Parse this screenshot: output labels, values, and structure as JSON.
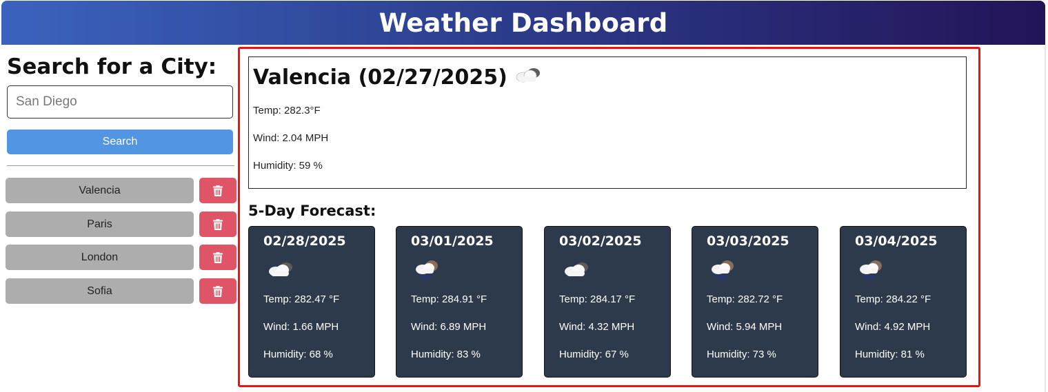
{
  "header": {
    "title": "Weather Dashboard"
  },
  "sidebar": {
    "search_title": "Search for a City:",
    "search_value": "",
    "search_placeholder": "San Diego",
    "search_button": "Search",
    "history": [
      {
        "city": "Valencia",
        "delete_icon": "trash-icon"
      },
      {
        "city": "Paris",
        "delete_icon": "trash-icon"
      },
      {
        "city": "London",
        "delete_icon": "trash-icon"
      },
      {
        "city": "Sofia",
        "delete_icon": "trash-icon"
      }
    ]
  },
  "current": {
    "title": "Valencia (02/27/2025)",
    "icon": "cloud-icon",
    "temp": "Temp: 282.3°F",
    "wind": "Wind: 2.04 MPH",
    "humidity": "Humidity: 59 %"
  },
  "forecast": {
    "title": "5-Day Forecast:",
    "days": [
      {
        "date": "02/28/2025",
        "icon": "cloud-icon",
        "temp": "Temp: 282.47 °F",
        "wind": "Wind: 1.66 MPH",
        "humidity": "Humidity: 68 %"
      },
      {
        "date": "03/01/2025",
        "icon": "rain-cloud-icon",
        "temp": "Temp: 284.91 °F",
        "wind": "Wind: 6.89 MPH",
        "humidity": "Humidity: 83 %"
      },
      {
        "date": "03/02/2025",
        "icon": "cloud-icon",
        "temp": "Temp: 284.17 °F",
        "wind": "Wind: 4.32 MPH",
        "humidity": "Humidity: 67 %"
      },
      {
        "date": "03/03/2025",
        "icon": "rain-cloud-icon",
        "temp": "Temp: 282.72 °F",
        "wind": "Wind: 5.94 MPH",
        "humidity": "Humidity: 73 %"
      },
      {
        "date": "03/04/2025",
        "icon": "rain-cloud-icon",
        "temp": "Temp: 284.22 °F",
        "wind": "Wind: 4.92 MPH",
        "humidity": "Humidity: 81 %"
      }
    ]
  },
  "colors": {
    "header_gradient_start": "#3b63be",
    "header_gradient_end": "#231458",
    "search_button": "#5296e2",
    "history_button": "#adadad",
    "delete_button": "#e05467",
    "forecast_card": "#2d3a4b",
    "highlight_frame": "#f01010"
  }
}
